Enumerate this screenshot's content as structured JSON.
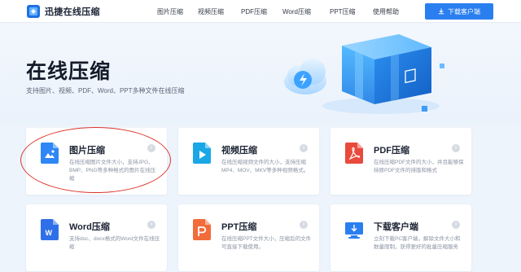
{
  "header": {
    "logo_text": "迅捷在线压缩",
    "nav": [
      {
        "label": "图片压缩"
      },
      {
        "label": "视频压缩"
      },
      {
        "label": "PDF压缩"
      },
      {
        "label": "Word压缩"
      },
      {
        "label": "PPT压缩"
      },
      {
        "label": "使用帮助"
      }
    ],
    "download_label": "下载客户端",
    "brand_color": "#2a7ff0"
  },
  "hero": {
    "title": "在线压缩",
    "subtitle": "支持图片、视频、PDF、Word、PPT多种文件在线压缩"
  },
  "cards": [
    {
      "title": "图片压缩",
      "desc": "在线压缩图片文件大小，支持JPG、BMP、PNG等多种格式的图片在线压缩",
      "icon": "image-file-icon",
      "color": "#2f86f6"
    },
    {
      "title": "视频压缩",
      "desc": "在线压缩视频文件的大小，支持压缩MP4、MOV、MKV等多种视频格式。",
      "icon": "video-file-icon",
      "color": "#1aa7e6"
    },
    {
      "title": "PDF压缩",
      "desc": "在线压缩PDF文件的大小，并且能够保持原PDF文件的排版和格式",
      "icon": "pdf-file-icon",
      "color": "#e84a3c"
    },
    {
      "title": "Word压缩",
      "desc": "支持doc、docx格式的Word文件在线压缩",
      "icon": "word-file-icon",
      "color": "#2f6fe8"
    },
    {
      "title": "PPT压缩",
      "desc": "在线压缩PPT文件大小，压缩后的文件可直接下载使用。",
      "icon": "ppt-file-icon",
      "color": "#f26b3a"
    },
    {
      "title": "下载客户端",
      "desc": "立刻下载PC客户端，解除文件大小和数量限制，获得更好的批量压缩服务",
      "icon": "desktop-download-icon",
      "color": "#2a7ff0"
    }
  ]
}
